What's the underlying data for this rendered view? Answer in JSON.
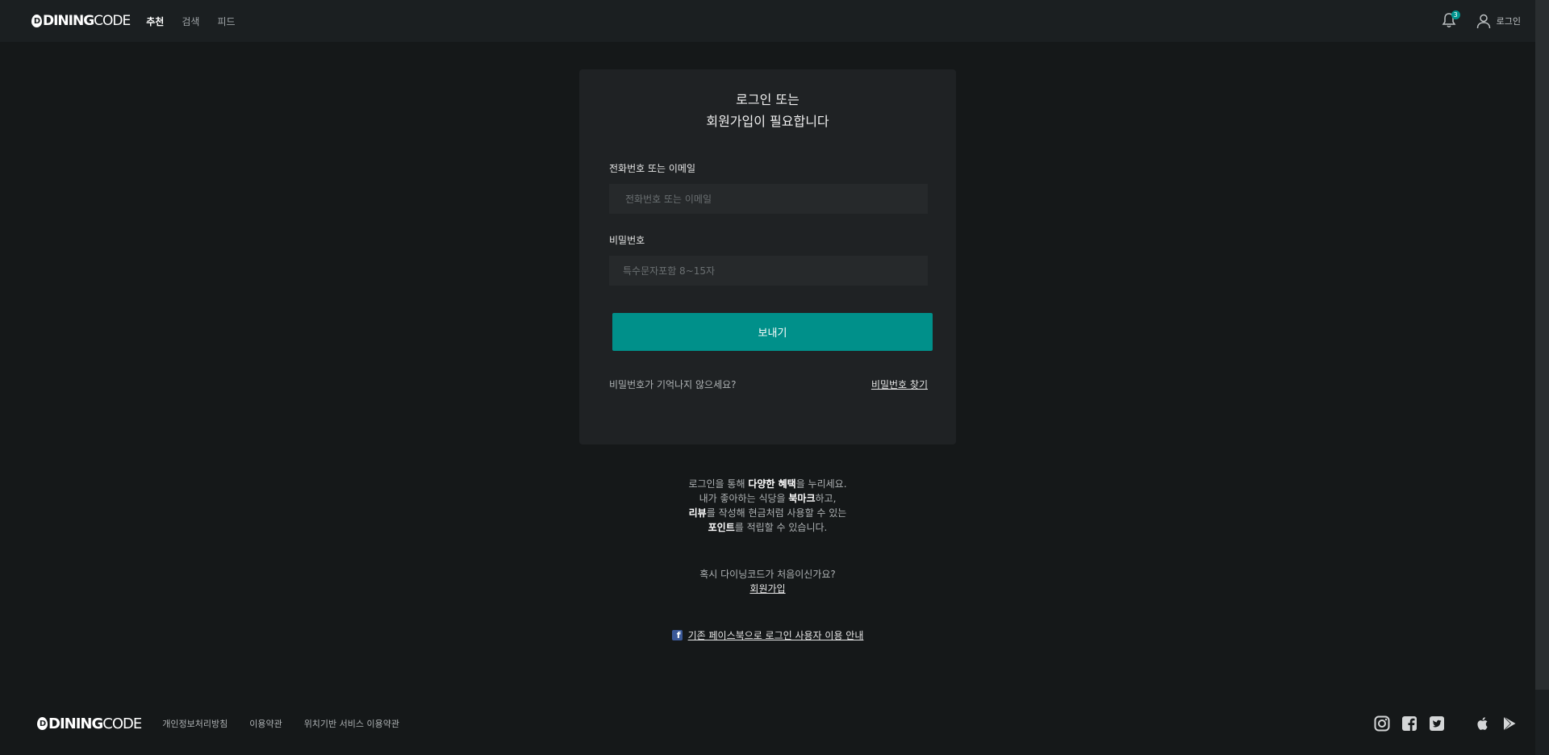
{
  "header": {
    "logo": {
      "mark": "D",
      "dining": "DINING",
      "code": "CODE"
    },
    "nav": [
      {
        "label": "추천",
        "active": true
      },
      {
        "label": "검색",
        "active": false
      },
      {
        "label": "피드",
        "active": false
      }
    ],
    "notification_badge": "3",
    "login_label": "로그인"
  },
  "card": {
    "title_line1": "로그인 또는",
    "title_line2": "회원가입이 필요합니다",
    "id_label": "전화번호 또는 이메일",
    "id_placeholder": "전화번호 또는 이메일",
    "password_label": "비밀번호",
    "password_placeholder": "특수문자포함 8~15자",
    "submit_label": "보내기",
    "forgot_text": "비밀번호가 기억나지 않으세요?",
    "forgot_link": "비밀번호 찾기"
  },
  "benefits": {
    "line1_pre": "로그인을 통해 ",
    "line1_bold": "다양한 혜택",
    "line1_post": "을 누리세요.",
    "line2_pre": "내가 좋아하는 식당을 ",
    "line2_bold": "북마크",
    "line2_post": "하고,",
    "line3_bold": "리뷰",
    "line3_post": "를 작성해 현금처럼 사용할 수 있는",
    "line4_bold": "포인트",
    "line4_post": "를 적립할 수 있습니다."
  },
  "signup": {
    "question": "혹시 다이닝코드가 처음이신가요?",
    "link": "회원가입"
  },
  "facebook_notice": "기존 페이스북으로 로그인 사용자 이용 안내",
  "footer": {
    "links": [
      "개인정보처리방침",
      "이용약관",
      "위치기반 서비스 이용약관"
    ],
    "icons": [
      "instagram-icon",
      "facebook-icon",
      "twitter-icon",
      "apple-icon",
      "google-play-icon"
    ]
  },
  "colors": {
    "background": "#151819",
    "card": "#1f2224",
    "accent": "#00908a"
  }
}
